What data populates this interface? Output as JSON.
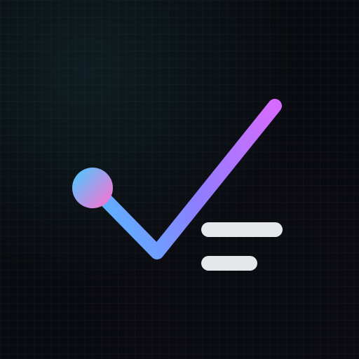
{
  "icon": {
    "name": "checklist-app-icon",
    "colors": {
      "background": "#0a0b10",
      "gradient_start": "#5fb0ff",
      "gradient_mid": "#8e7dff",
      "gradient_end": "#d66cff",
      "dot_start": "#4ec7ff",
      "dot_end": "#ff70d2",
      "lines": "#e6e7ea"
    }
  }
}
